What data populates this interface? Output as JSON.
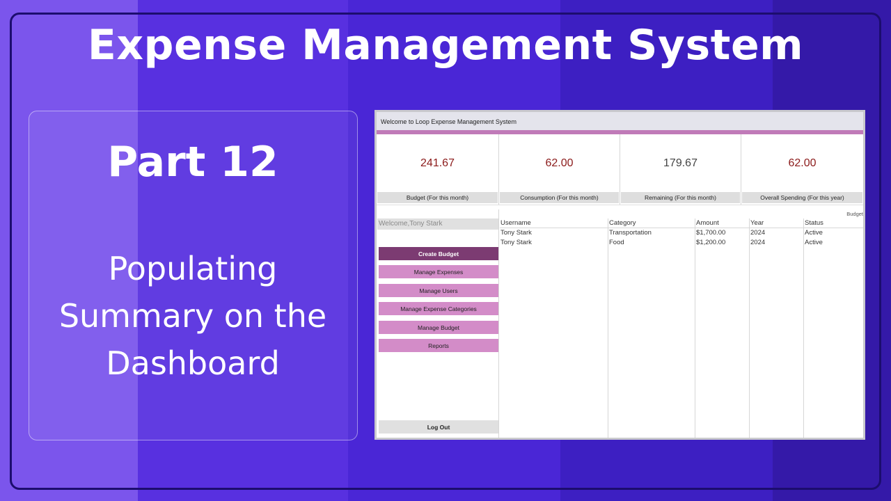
{
  "header": {
    "title": "Expense Management System"
  },
  "left_card": {
    "part": "Part 12",
    "subtitle_lines": [
      "Populating",
      "Summary on the",
      "Dashboard"
    ]
  },
  "colors": {
    "accent": "#c07ab8",
    "menu_button": "#d38cc8",
    "active_button": "#7c3b72",
    "value_red": "#8b1a1a",
    "value_gray": "#444444"
  },
  "app": {
    "window_title": "Welcome to Loop Expense Management System",
    "kpis": [
      {
        "value": "241.67",
        "label": "Budget (For this month)",
        "color": "#8b1a1a"
      },
      {
        "value": "62.00",
        "label": "Consumption (For this month)",
        "color": "#8b1a1a"
      },
      {
        "value": "179.67",
        "label": "Remaining (For this month)",
        "color": "#444444"
      },
      {
        "value": "62.00",
        "label": "Overall Spending (For this year)",
        "color": "#8b1a1a"
      }
    ],
    "welcome_text": "Welcome,Tony Stark",
    "menu": [
      {
        "label": "Create Budget",
        "active": true
      },
      {
        "label": "Manage Expenses",
        "active": false
      },
      {
        "label": "Manage Users",
        "active": false
      },
      {
        "label": "Manage Expense Categories",
        "active": false
      },
      {
        "label": "Manage Budget",
        "active": false
      },
      {
        "label": "Reports",
        "active": false
      }
    ],
    "logout_label": "Log Out",
    "grid_tag": "Budget",
    "table": {
      "columns": [
        "Username",
        "Category",
        "Amount",
        "Year",
        "Status"
      ],
      "rows": [
        [
          "Tony Stark",
          "Transportation",
          "$1,700.00",
          "2024",
          "Active"
        ],
        [
          "Tony Stark",
          "Food",
          "$1,200.00",
          "2024",
          "Active"
        ]
      ]
    }
  }
}
